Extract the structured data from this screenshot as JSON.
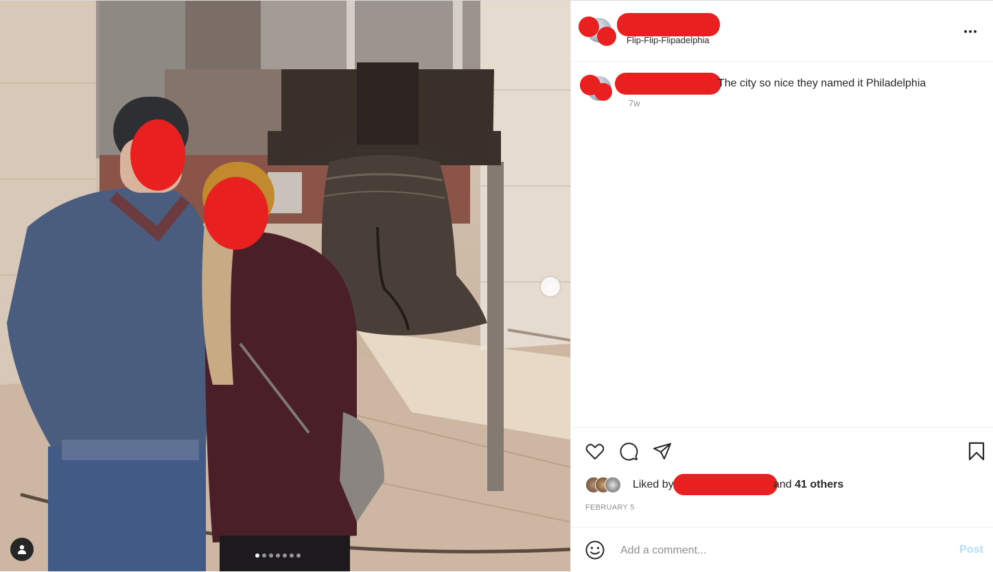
{
  "post": {
    "location": "Flip-Flip-Flipadelphia",
    "caption": "The city so nice they named it Philadelphia",
    "time_ago": "7w",
    "liked_by_prefix": "Liked by",
    "liked_by_and": "and",
    "liked_by_others": "41 others",
    "date": "FEBRUARY 5",
    "carousel_count": 7,
    "carousel_active_index": 0
  },
  "comment": {
    "placeholder": "Add a comment...",
    "post_label": "Post"
  },
  "icons": {
    "more": "more-horizontal-icon",
    "like": "heart-icon",
    "comment": "comment-bubble-icon",
    "share": "paper-plane-icon",
    "save": "bookmark-icon",
    "emoji": "smiley-icon",
    "next": "chevron-right-icon",
    "user_tag": "person-icon"
  },
  "colors": {
    "redaction": "#e8201f",
    "post_button_disabled": "#b3dbff",
    "secondary_text": "#8e8e8e"
  }
}
